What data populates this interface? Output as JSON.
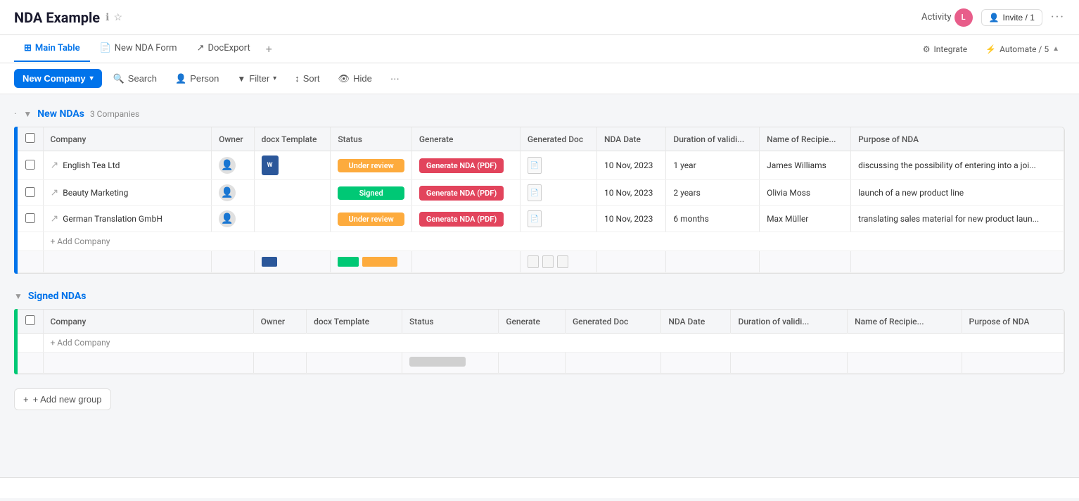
{
  "header": {
    "title": "NDA Example",
    "activity_label": "Activity",
    "invite_label": "Invite / 1",
    "avatar_initial": "L",
    "more_label": "···"
  },
  "tabs": {
    "items": [
      {
        "label": "Main Table",
        "active": true,
        "icon": "table-icon"
      },
      {
        "label": "New NDA Form",
        "active": false,
        "icon": "form-icon"
      },
      {
        "label": "DocExport",
        "active": false,
        "icon": "export-icon"
      }
    ],
    "add_label": "+",
    "integrate_label": "Integrate",
    "automate_label": "Automate / 5"
  },
  "toolbar": {
    "new_company_label": "New Company",
    "search_label": "Search",
    "person_label": "Person",
    "filter_label": "Filter",
    "sort_label": "Sort",
    "hide_label": "Hide",
    "more_label": "···"
  },
  "new_ndas_group": {
    "title": "New NDAs",
    "count_label": "3 Companies",
    "columns": [
      "Company",
      "Owner",
      "docx Template",
      "Status",
      "Generate",
      "Generated Doc",
      "NDA Date",
      "Duration of validi...",
      "Name of Recipie...",
      "Purpose of NDA"
    ],
    "rows": [
      {
        "company": "English Tea Ltd",
        "owner": "",
        "docx": true,
        "status": "Under review",
        "status_type": "under-review",
        "generate": "Generate NDA (PDF)",
        "generated_doc": "",
        "nda_date": "10 Nov, 2023",
        "duration": "1 year",
        "recipient": "James Williams",
        "purpose": "discussing the possibility of entering into a joi..."
      },
      {
        "company": "Beauty Marketing",
        "owner": "",
        "docx": false,
        "status": "Signed",
        "status_type": "signed",
        "generate": "Generate NDA (PDF)",
        "generated_doc": "",
        "nda_date": "10 Nov, 2023",
        "duration": "2 years",
        "recipient": "Olivia Moss",
        "purpose": "launch of a new product line"
      },
      {
        "company": "German Translation GmbH",
        "owner": "",
        "docx": false,
        "status": "Under review",
        "status_type": "under-review",
        "generate": "Generate NDA (PDF)",
        "generated_doc": "",
        "nda_date": "10 Nov, 2023",
        "duration": "6 months",
        "recipient": "Max Müller",
        "purpose": "translating sales material for new product laun..."
      }
    ],
    "add_label": "+ Add Company"
  },
  "signed_ndas_group": {
    "title": "Signed NDAs",
    "columns": [
      "Company",
      "Owner",
      "docx Template",
      "Status",
      "Generate",
      "Generated Doc",
      "NDA Date",
      "Duration of validi...",
      "Name of Recipie...",
      "Purpose of NDA"
    ],
    "rows": [],
    "add_label": "+ Add Company"
  },
  "add_group": {
    "label": "+ Add new group"
  },
  "colors": {
    "blue": "#0073ea",
    "green": "#00c875",
    "orange": "#fdab3d",
    "red": "#e2445c"
  }
}
